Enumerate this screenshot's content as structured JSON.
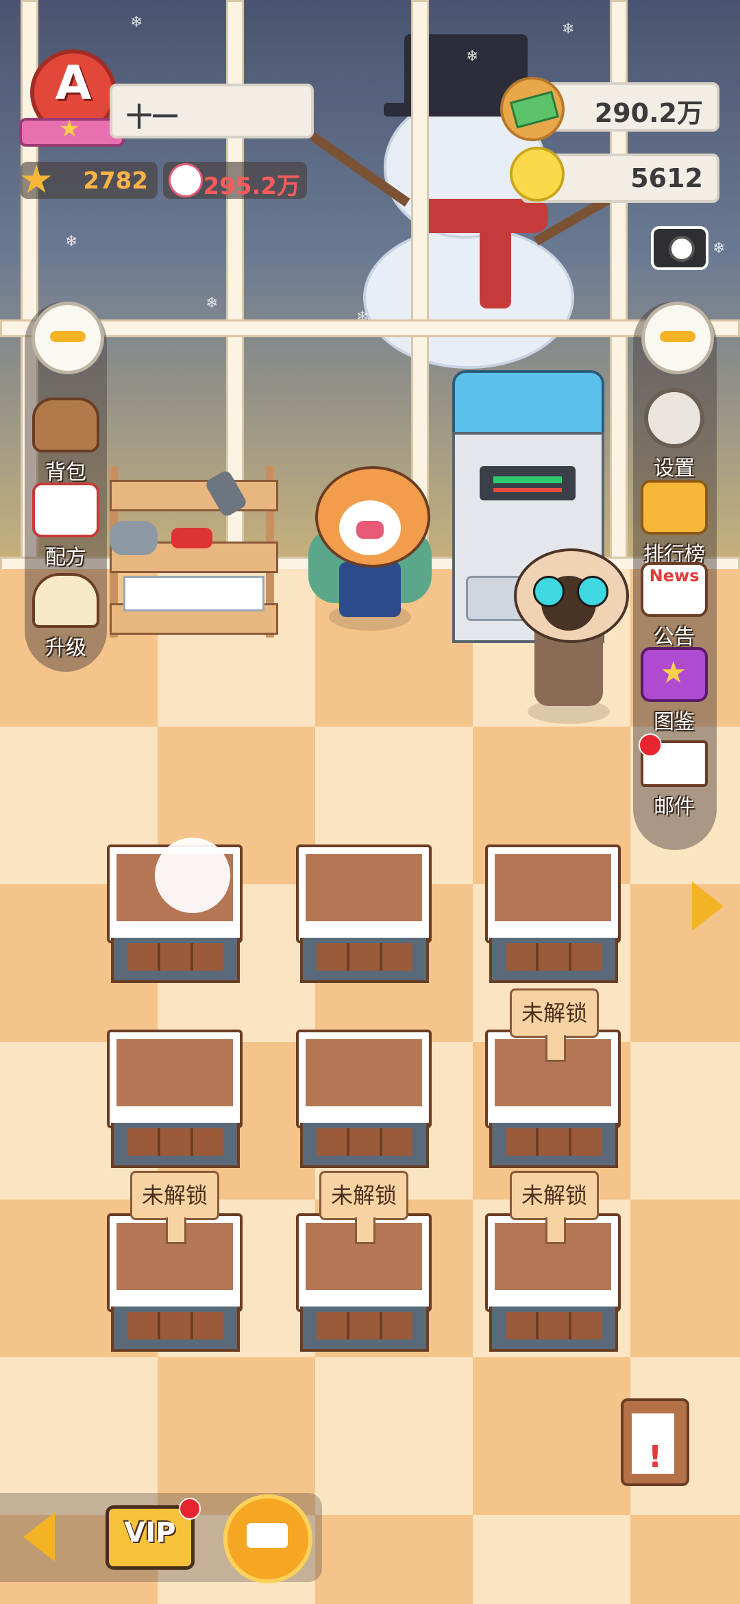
{
  "player": {
    "rank_letter": "A",
    "name": "十一",
    "stars": "2782",
    "fans": "295.2万"
  },
  "currency": {
    "money": "290.2万",
    "ideas": "5612"
  },
  "left_menu": [
    {
      "label": "背包",
      "icon": "backpack-icon"
    },
    {
      "label": "配方",
      "icon": "recipe-book-icon"
    },
    {
      "label": "升级",
      "icon": "upgrade-icon"
    }
  ],
  "right_menu": [
    {
      "label": "设置",
      "icon": "gear-icon"
    },
    {
      "label": "排行榜",
      "icon": "podium-icon"
    },
    {
      "label": "公告",
      "icon": "news-icon",
      "badge_text": "News"
    },
    {
      "label": "图鉴",
      "icon": "star-book-icon"
    },
    {
      "label": "邮件",
      "icon": "mail-icon"
    }
  ],
  "tables": {
    "locked_label": "未解锁"
  },
  "bottom": {
    "vip_label": "VIP"
  },
  "colors": {
    "accent_yellow": "#f3b325",
    "rank_red": "#e2473a",
    "fans_red": "#ff5b5b",
    "stars_orange": "#ffb347"
  }
}
